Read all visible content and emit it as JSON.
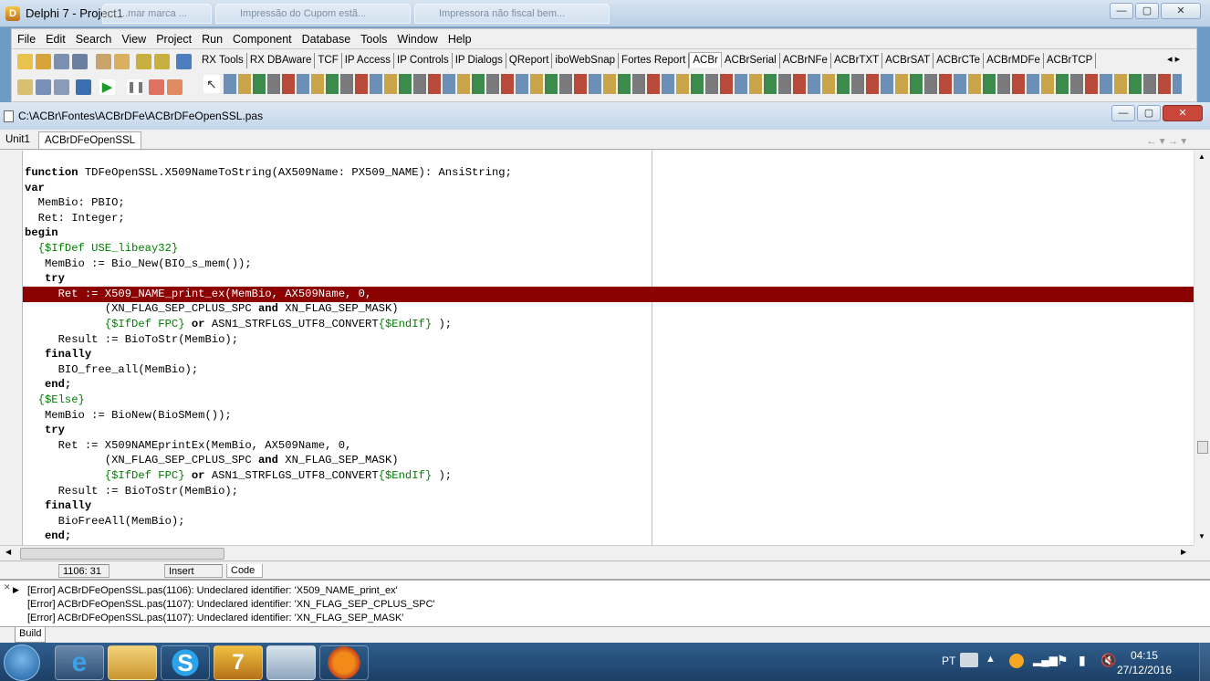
{
  "window": {
    "title": "Delphi 7 - Project1",
    "ghost_tabs": [
      "...mar marca ...",
      "Impressão do Cupom estã...",
      "Impressora não fiscal bem..."
    ],
    "min": "—",
    "max": "▢",
    "close": "✕"
  },
  "menu": [
    "File",
    "Edit",
    "Search",
    "View",
    "Project",
    "Run",
    "Component",
    "Database",
    "Tools",
    "Window",
    "Help"
  ],
  "palette_tabs": [
    "RX Tools",
    "RX DBAware",
    "TCF",
    "IP Access",
    "IP Controls",
    "IP Dialogs",
    "QReport",
    "iboWebSnap",
    "Fortes Report",
    "ACBr",
    "ACBrSerial",
    "ACBrNFe",
    "ACBrTXT",
    "ACBrSAT",
    "ACBrCTe",
    "ACBrMDFe",
    "ACBrTCP"
  ],
  "palette_selected": "ACBr",
  "editor": {
    "title": "C:\\ACBr\\Fontes\\ACBrDFe\\ACBrDFeOpenSSL.pas",
    "tabs": [
      "Unit1",
      "ACBrDFeOpenSSL"
    ],
    "active_tab": "ACBrDFeOpenSSL",
    "nav": "← ▾ → ▾"
  },
  "code_lines": [
    [
      [
        "kw",
        "function"
      ],
      [
        "n",
        " TDFeOpenSSL.X509NameToString(AX509Name: PX509_NAME): AnsiString;"
      ]
    ],
    [
      [
        "kw",
        "var"
      ]
    ],
    [
      [
        "n",
        "  MemBio: PBIO;"
      ]
    ],
    [
      [
        "n",
        "  Ret: Integer;"
      ]
    ],
    [
      [
        "kw",
        "begin"
      ]
    ],
    [
      [
        "dir",
        "  {$IfDef USE_libeay32}"
      ]
    ],
    [
      [
        "n",
        "   MemBio := Bio_New(BIO_s_mem());"
      ]
    ],
    [
      [
        "kw",
        "   try"
      ]
    ],
    [
      [
        "n",
        "     Ret := X509_NAME_print_ex(MemBio, AX509Name, 0,"
      ]
    ],
    [
      [
        "n",
        "            (XN_FLAG_SEP_CPLUS_SPC "
      ],
      [
        "kw",
        "and"
      ],
      [
        "n",
        " XN_FLAG_SEP_MASK)"
      ]
    ],
    [
      [
        "n",
        "            "
      ],
      [
        "dir",
        "{$IfDef FPC}"
      ],
      [
        "n",
        " "
      ],
      [
        "kw",
        "or"
      ],
      [
        "n",
        " ASN1_STRFLGS_UTF8_CONVERT"
      ],
      [
        "dir",
        "{$EndIf}"
      ],
      [
        "n",
        " );"
      ]
    ],
    [
      [
        "n",
        "     Result := BioToStr(MemBio);"
      ]
    ],
    [
      [
        "kw",
        "   finally"
      ]
    ],
    [
      [
        "n",
        "     BIO_free_all(MemBio);"
      ]
    ],
    [
      [
        "kw",
        "   end;"
      ]
    ],
    [
      [
        "dir",
        "  {$Else}"
      ]
    ],
    [
      [
        "n",
        "   MemBio := BioNew(BioSMem());"
      ]
    ],
    [
      [
        "kw",
        "   try"
      ]
    ],
    [
      [
        "n",
        "     Ret := X509NAMEprintEx(MemBio, AX509Name, 0,"
      ]
    ],
    [
      [
        "n",
        "            (XN_FLAG_SEP_CPLUS_SPC "
      ],
      [
        "kw",
        "and"
      ],
      [
        "n",
        " XN_FLAG_SEP_MASK)"
      ]
    ],
    [
      [
        "n",
        "            "
      ],
      [
        "dir",
        "{$IfDef FPC}"
      ],
      [
        "n",
        " "
      ],
      [
        "kw",
        "or"
      ],
      [
        "n",
        " ASN1_STRFLGS_UTF8_CONVERT"
      ],
      [
        "dir",
        "{$EndIf}"
      ],
      [
        "n",
        " );"
      ]
    ],
    [
      [
        "n",
        "     Result := BioToStr(MemBio);"
      ]
    ],
    [
      [
        "kw",
        "   finally"
      ]
    ],
    [
      [
        "n",
        "     BioFreeAll(MemBio);"
      ]
    ],
    [
      [
        "kw",
        "   end;"
      ]
    ]
  ],
  "error_line_index": 8,
  "status": {
    "position": "1106: 31",
    "mode": "Insert",
    "view_tab": "Code"
  },
  "messages": [
    "[Error] ACBrDFeOpenSSL.pas(1106): Undeclared identifier: 'X509_NAME_print_ex'",
    "[Error] ACBrDFeOpenSSL.pas(1107): Undeclared identifier: 'XN_FLAG_SEP_CPLUS_SPC'",
    "[Error] ACBrDFeOpenSSL.pas(1107): Undeclared identifier: 'XN_FLAG_SEP_MASK'"
  ],
  "build_tab": "Build",
  "taskbar": {
    "lang": "PT",
    "time": "04:15",
    "date": "27/12/2016"
  },
  "colors": {
    "error_line": "#8b0000",
    "directive": "#008000",
    "taskbar": "#1c3f66"
  }
}
